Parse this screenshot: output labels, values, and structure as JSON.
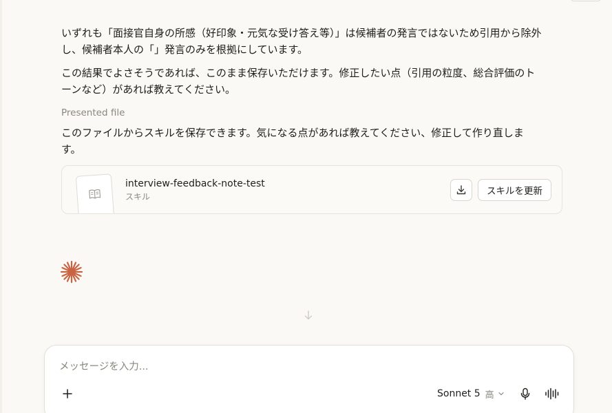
{
  "message": {
    "paragraph1": "いずれも「面接官自身の所感（好印象・元気な受け答え等）」は候補者の発言ではないため引用から除外し、候補者本人の「」発言のみを根拠にしています。",
    "paragraph2": "この結果でよさそうであれば、このまま保存いただけます。修正したい点（引用の粒度、総合評価のトーンなど）があれば教えてください。",
    "presented_label": "Presented file",
    "paragraph3": "このファイルからスキルを保存できます。気になる点があれば教えてください、修正して作り直します。"
  },
  "file_card": {
    "name": "interview-feedback-note-test",
    "type": "スキル",
    "update_label": "スキルを更新",
    "icons": {
      "thumbnail": "book-icon",
      "download": "download-icon"
    }
  },
  "assistant": {
    "spark_icon": "spark-icon",
    "accent_color": "#c96442"
  },
  "composer": {
    "placeholder": "メッセージを入力...",
    "value": "",
    "model": "Sonnet 5",
    "level": "高",
    "icons": {
      "add": "plus-icon",
      "model_dropdown": "chevron-down-icon",
      "mic": "microphone-icon",
      "voice": "voice-waveform-icon",
      "scroll": "arrow-down-icon"
    }
  }
}
